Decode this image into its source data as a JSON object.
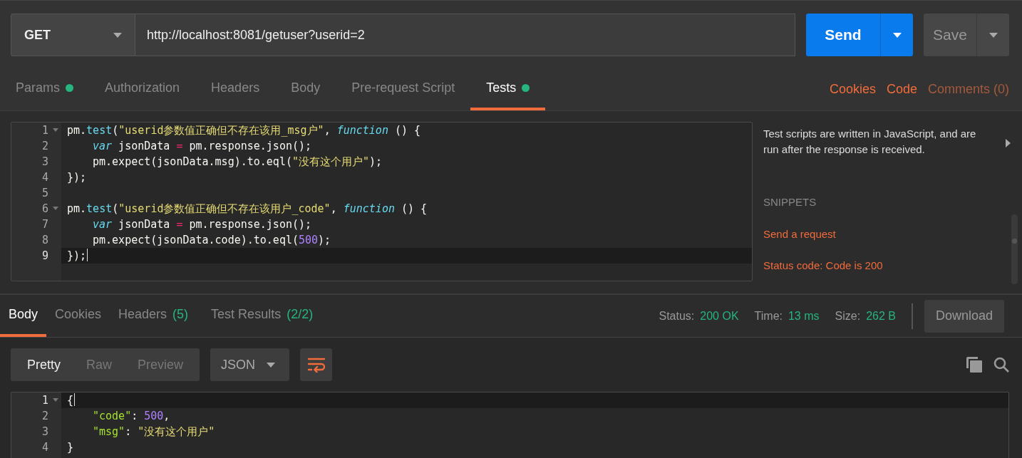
{
  "request": {
    "method": "GET",
    "url": "http://localhost:8081/getuser?userid=2",
    "send": "Send",
    "save": "Save"
  },
  "request_tabs": [
    {
      "label": "Params",
      "dot": true,
      "selected": false
    },
    {
      "label": "Authorization",
      "dot": false,
      "selected": false
    },
    {
      "label": "Headers",
      "dot": false,
      "selected": false
    },
    {
      "label": "Body",
      "dot": false,
      "selected": false
    },
    {
      "label": "Pre-request Script",
      "dot": false,
      "selected": false
    },
    {
      "label": "Tests",
      "dot": true,
      "selected": true
    }
  ],
  "side_links": [
    {
      "label": "Cookies",
      "kind": "link"
    },
    {
      "label": "Code",
      "kind": "link"
    },
    {
      "label": "Comments (0)",
      "kind": "muted"
    }
  ],
  "tests_editor": {
    "lines": [
      {
        "number": "1",
        "fold": true,
        "current": false,
        "indented": false,
        "tokens": [
          {
            "text": "pm.",
            "kind": "plain"
          },
          {
            "text": "test",
            "kind": "fn"
          },
          {
            "text": "(",
            "kind": "plain"
          },
          {
            "text": "\"userid参数值正确但不存在该用_msg户\"",
            "kind": "str"
          },
          {
            "text": ", ",
            "kind": "plain"
          },
          {
            "text": "function",
            "kind": "kw"
          },
          {
            "text": " () {",
            "kind": "plain"
          }
        ]
      },
      {
        "number": "2",
        "fold": false,
        "current": false,
        "indented": true,
        "tokens": [
          {
            "text": "var",
            "kind": "kw"
          },
          {
            "text": " jsonData ",
            "kind": "plain"
          },
          {
            "text": "=",
            "kind": "op"
          },
          {
            "text": " pm.response.json();",
            "kind": "plain"
          }
        ]
      },
      {
        "number": "3",
        "fold": false,
        "current": false,
        "indented": true,
        "tokens": [
          {
            "text": "pm.expect(jsonData.msg).to.eql(",
            "kind": "plain"
          },
          {
            "text": "\"没有这个用户\"",
            "kind": "str"
          },
          {
            "text": ");",
            "kind": "plain"
          }
        ]
      },
      {
        "number": "4",
        "fold": false,
        "current": false,
        "indented": false,
        "tokens": [
          {
            "text": "});",
            "kind": "plain"
          }
        ]
      },
      {
        "number": "5",
        "fold": false,
        "current": false
      },
      {
        "number": "6",
        "fold": true,
        "current": false,
        "indented": false,
        "tokens": [
          {
            "text": "pm.",
            "kind": "plain"
          },
          {
            "text": "test",
            "kind": "fn"
          },
          {
            "text": "(",
            "kind": "plain"
          },
          {
            "text": "\"userid参数值正确但不存在该用户_code\"",
            "kind": "str"
          },
          {
            "text": ", ",
            "kind": "plain"
          },
          {
            "text": "function",
            "kind": "kw"
          },
          {
            "text": " () {",
            "kind": "plain"
          }
        ]
      },
      {
        "number": "7",
        "fold": false,
        "current": false,
        "indented": true,
        "tokens": [
          {
            "text": "var",
            "kind": "kw"
          },
          {
            "text": " jsonData ",
            "kind": "plain"
          },
          {
            "text": "=",
            "kind": "op"
          },
          {
            "text": " pm.response.json();",
            "kind": "plain"
          }
        ]
      },
      {
        "number": "8",
        "fold": false,
        "current": false,
        "indented": true,
        "tokens": [
          {
            "text": "pm.expect(jsonData.code).to.eql(",
            "kind": "plain"
          },
          {
            "text": "500",
            "kind": "num"
          },
          {
            "text": ");",
            "kind": "plain"
          }
        ]
      },
      {
        "number": "9",
        "fold": false,
        "current": true,
        "indented": false,
        "tokens": [
          {
            "text": "});",
            "kind": "plain"
          }
        ]
      }
    ]
  },
  "tests_help": {
    "text": "Test scripts are written in JavaScript, and are run after the response is received.",
    "snippets_title": "SNIPPETS",
    "snippets": [
      "Send a request",
      "Status code: Code is 200"
    ]
  },
  "response_tabs": [
    {
      "label": "Body",
      "selected": true
    },
    {
      "label": "Cookies",
      "selected": false
    },
    {
      "label": "Headers",
      "count": "(5)",
      "selected": false
    },
    {
      "label": "Test Results",
      "count": "(2/2)",
      "selected": false
    }
  ],
  "stats": [
    {
      "label": "Status:",
      "value": "200 OK"
    },
    {
      "label": "Time:",
      "value": "13 ms"
    },
    {
      "label": "Size:",
      "value": "262 B"
    }
  ],
  "download": "Download",
  "view_modes": [
    {
      "label": "Pretty",
      "selected": true
    },
    {
      "label": "Raw",
      "selected": false
    },
    {
      "label": "Preview",
      "selected": false
    }
  ],
  "format": "JSON",
  "body_lines": [
    {
      "number": "1",
      "fold": true,
      "current": true,
      "indented": false,
      "tokens": [
        {
          "text": "{",
          "kind": "plain"
        }
      ]
    },
    {
      "number": "2",
      "fold": false,
      "current": false,
      "indented": true,
      "tokens": [
        {
          "text": "\"code\"",
          "kind": "key"
        },
        {
          "text": ": ",
          "kind": "plain"
        },
        {
          "text": "500",
          "kind": "num"
        },
        {
          "text": ",",
          "kind": "plain"
        }
      ]
    },
    {
      "number": "3",
      "fold": false,
      "current": false,
      "indented": true,
      "tokens": [
        {
          "text": "\"msg\"",
          "kind": "key"
        },
        {
          "text": ": ",
          "kind": "plain"
        },
        {
          "text": "\"没有这个用户\"",
          "kind": "str"
        }
      ]
    },
    {
      "number": "4",
      "fold": false,
      "current": false,
      "indented": false,
      "tokens": [
        {
          "text": "}",
          "kind": "plain"
        }
      ]
    }
  ]
}
